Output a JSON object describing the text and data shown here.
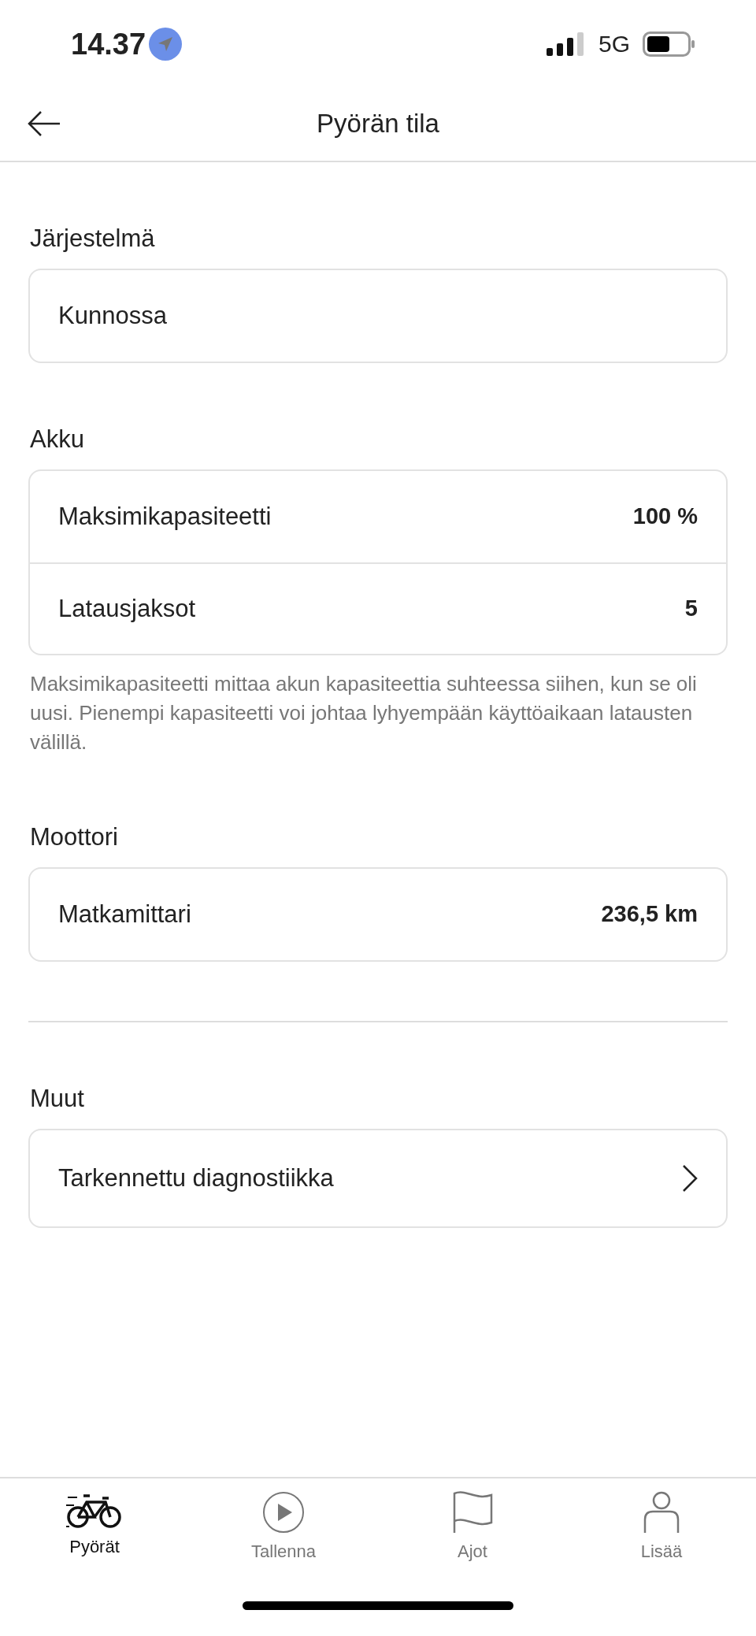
{
  "status_bar": {
    "time": "14.37",
    "network": "5G"
  },
  "header": {
    "title": "Pyörän tila"
  },
  "sections": [
    {
      "title": "Järjestelmä",
      "rows": [
        {
          "kind": "text",
          "label": "Kunnossa"
        }
      ]
    },
    {
      "title": "Akku",
      "rows": [
        {
          "kind": "value",
          "label": "Maksimikapasiteetti",
          "value": "100 %"
        },
        {
          "kind": "value",
          "label": "Latausjaksot",
          "value": "5"
        }
      ],
      "note": "Maksimikapasiteetti mittaa akun kapasiteettia suhteessa siihen, kun se oli uusi. Pienempi kapasiteetti voi johtaa lyhyempään käyttöaikaan latausten välillä."
    },
    {
      "title": "Moottori",
      "rows": [
        {
          "kind": "value",
          "label": "Matkamittari",
          "value": "236,5 km"
        }
      ]
    },
    {
      "title": "Muut",
      "divider_before": true,
      "rows": [
        {
          "kind": "link",
          "label": "Tarkennettu diagnostiikka"
        }
      ]
    }
  ],
  "tabs": [
    {
      "label": "Pyörät",
      "kind": "bike",
      "selected": true
    },
    {
      "label": "Tallenna",
      "kind": "play",
      "selected": false
    },
    {
      "label": "Ajot",
      "kind": "flag",
      "selected": false
    },
    {
      "label": "Lisää",
      "kind": "person",
      "selected": false
    }
  ]
}
